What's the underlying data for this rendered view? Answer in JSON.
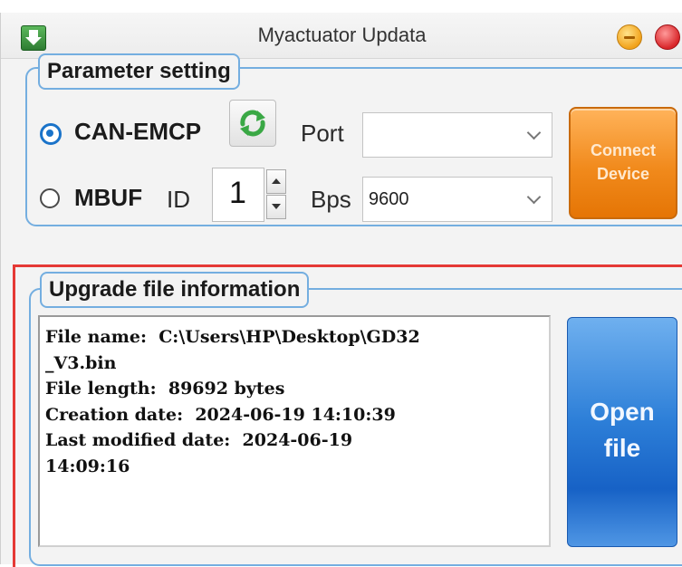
{
  "window": {
    "title": "Myactuator Updata"
  },
  "parameter_setting": {
    "title": "Parameter setting",
    "mode_options": [
      {
        "label": "CAN-EMCP",
        "selected": true
      },
      {
        "label": "MBUF",
        "selected": false
      }
    ],
    "id_label": "ID",
    "id_value": "1",
    "port_label": "Port",
    "port_value": "",
    "bps_label": "Bps",
    "bps_value": "9600",
    "connect_button": {
      "line1": "Connect",
      "line2": "Device"
    }
  },
  "upgrade_file_information": {
    "title": "Upgrade file information",
    "info_lines": [
      "File name:  C:\\Users\\HP\\Desktop\\GD32",
      "_V3.bin",
      "File length:  89692 bytes",
      "Creation date:  2024-06-19 14:10:39",
      "Last modified date:  2024-06-19",
      "14:09:16"
    ],
    "open_button": {
      "line1": "Open",
      "line2": "file"
    }
  },
  "colors": {
    "connect_button": "#f18a1c",
    "open_button": "#2d7fd8",
    "group_border": "#74aee0",
    "highlight_frame": "#e53935",
    "radio_selected": "#1a73c9"
  },
  "icons": {
    "app": "download-arrow-icon",
    "refresh": "refresh-icon",
    "minimize": "minimize-icon",
    "close": "close-icon"
  }
}
